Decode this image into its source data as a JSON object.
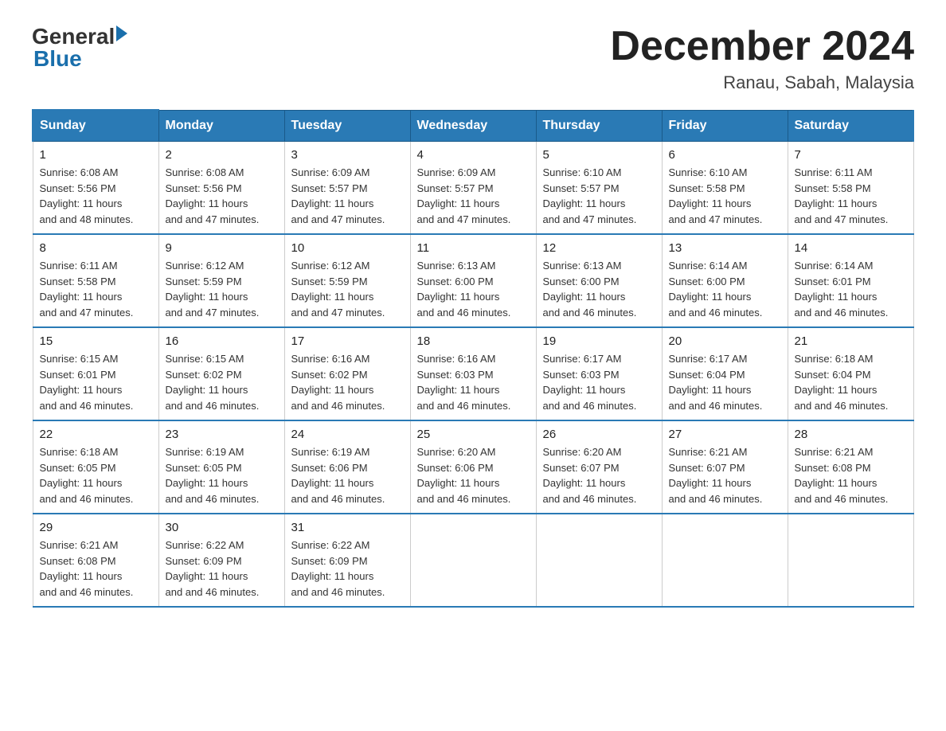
{
  "logo": {
    "general": "General",
    "blue": "Blue",
    "arrow_color": "#1a6fac"
  },
  "header": {
    "month_year": "December 2024",
    "location": "Ranau, Sabah, Malaysia"
  },
  "days_of_week": [
    "Sunday",
    "Monday",
    "Tuesday",
    "Wednesday",
    "Thursday",
    "Friday",
    "Saturday"
  ],
  "weeks": [
    [
      {
        "day": "1",
        "sunrise": "6:08 AM",
        "sunset": "5:56 PM",
        "daylight": "11 hours and 48 minutes."
      },
      {
        "day": "2",
        "sunrise": "6:08 AM",
        "sunset": "5:56 PM",
        "daylight": "11 hours and 47 minutes."
      },
      {
        "day": "3",
        "sunrise": "6:09 AM",
        "sunset": "5:57 PM",
        "daylight": "11 hours and 47 minutes."
      },
      {
        "day": "4",
        "sunrise": "6:09 AM",
        "sunset": "5:57 PM",
        "daylight": "11 hours and 47 minutes."
      },
      {
        "day": "5",
        "sunrise": "6:10 AM",
        "sunset": "5:57 PM",
        "daylight": "11 hours and 47 minutes."
      },
      {
        "day": "6",
        "sunrise": "6:10 AM",
        "sunset": "5:58 PM",
        "daylight": "11 hours and 47 minutes."
      },
      {
        "day": "7",
        "sunrise": "6:11 AM",
        "sunset": "5:58 PM",
        "daylight": "11 hours and 47 minutes."
      }
    ],
    [
      {
        "day": "8",
        "sunrise": "6:11 AM",
        "sunset": "5:58 PM",
        "daylight": "11 hours and 47 minutes."
      },
      {
        "day": "9",
        "sunrise": "6:12 AM",
        "sunset": "5:59 PM",
        "daylight": "11 hours and 47 minutes."
      },
      {
        "day": "10",
        "sunrise": "6:12 AM",
        "sunset": "5:59 PM",
        "daylight": "11 hours and 47 minutes."
      },
      {
        "day": "11",
        "sunrise": "6:13 AM",
        "sunset": "6:00 PM",
        "daylight": "11 hours and 46 minutes."
      },
      {
        "day": "12",
        "sunrise": "6:13 AM",
        "sunset": "6:00 PM",
        "daylight": "11 hours and 46 minutes."
      },
      {
        "day": "13",
        "sunrise": "6:14 AM",
        "sunset": "6:00 PM",
        "daylight": "11 hours and 46 minutes."
      },
      {
        "day": "14",
        "sunrise": "6:14 AM",
        "sunset": "6:01 PM",
        "daylight": "11 hours and 46 minutes."
      }
    ],
    [
      {
        "day": "15",
        "sunrise": "6:15 AM",
        "sunset": "6:01 PM",
        "daylight": "11 hours and 46 minutes."
      },
      {
        "day": "16",
        "sunrise": "6:15 AM",
        "sunset": "6:02 PM",
        "daylight": "11 hours and 46 minutes."
      },
      {
        "day": "17",
        "sunrise": "6:16 AM",
        "sunset": "6:02 PM",
        "daylight": "11 hours and 46 minutes."
      },
      {
        "day": "18",
        "sunrise": "6:16 AM",
        "sunset": "6:03 PM",
        "daylight": "11 hours and 46 minutes."
      },
      {
        "day": "19",
        "sunrise": "6:17 AM",
        "sunset": "6:03 PM",
        "daylight": "11 hours and 46 minutes."
      },
      {
        "day": "20",
        "sunrise": "6:17 AM",
        "sunset": "6:04 PM",
        "daylight": "11 hours and 46 minutes."
      },
      {
        "day": "21",
        "sunrise": "6:18 AM",
        "sunset": "6:04 PM",
        "daylight": "11 hours and 46 minutes."
      }
    ],
    [
      {
        "day": "22",
        "sunrise": "6:18 AM",
        "sunset": "6:05 PM",
        "daylight": "11 hours and 46 minutes."
      },
      {
        "day": "23",
        "sunrise": "6:19 AM",
        "sunset": "6:05 PM",
        "daylight": "11 hours and 46 minutes."
      },
      {
        "day": "24",
        "sunrise": "6:19 AM",
        "sunset": "6:06 PM",
        "daylight": "11 hours and 46 minutes."
      },
      {
        "day": "25",
        "sunrise": "6:20 AM",
        "sunset": "6:06 PM",
        "daylight": "11 hours and 46 minutes."
      },
      {
        "day": "26",
        "sunrise": "6:20 AM",
        "sunset": "6:07 PM",
        "daylight": "11 hours and 46 minutes."
      },
      {
        "day": "27",
        "sunrise": "6:21 AM",
        "sunset": "6:07 PM",
        "daylight": "11 hours and 46 minutes."
      },
      {
        "day": "28",
        "sunrise": "6:21 AM",
        "sunset": "6:08 PM",
        "daylight": "11 hours and 46 minutes."
      }
    ],
    [
      {
        "day": "29",
        "sunrise": "6:21 AM",
        "sunset": "6:08 PM",
        "daylight": "11 hours and 46 minutes."
      },
      {
        "day": "30",
        "sunrise": "6:22 AM",
        "sunset": "6:09 PM",
        "daylight": "11 hours and 46 minutes."
      },
      {
        "day": "31",
        "sunrise": "6:22 AM",
        "sunset": "6:09 PM",
        "daylight": "11 hours and 46 minutes."
      },
      null,
      null,
      null,
      null
    ]
  ],
  "labels": {
    "sunrise": "Sunrise:",
    "sunset": "Sunset:",
    "daylight": "Daylight:"
  }
}
